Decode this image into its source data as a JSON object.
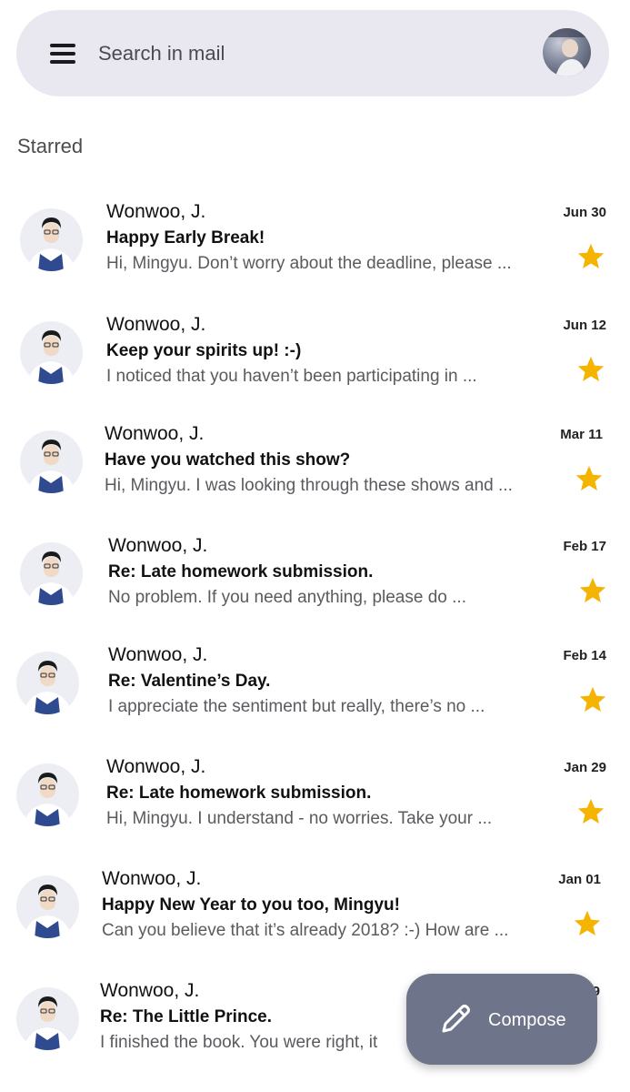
{
  "search": {
    "placeholder": "Search in mail"
  },
  "section": {
    "title": "Starred"
  },
  "emails": [
    {
      "sender": "Wonwoo, J.",
      "subject": "Happy Early Break!",
      "snippet": "Hi, Mingyu. Don’t worry about the deadline, please ...",
      "date": "Jun 30",
      "starred": true
    },
    {
      "sender": "Wonwoo, J.",
      "subject": "Keep your spirits up! :-)",
      "snippet": "I noticed that you haven’t been participating in ...",
      "date": "Jun 12",
      "starred": true
    },
    {
      "sender": "Wonwoo, J.",
      "subject": "Have you watched this show?",
      "snippet": "Hi, Mingyu. I was looking through these shows and ...",
      "date": "Mar 11",
      "starred": true
    },
    {
      "sender": "Wonwoo, J.",
      "subject": "Re: Late homework submission.",
      "snippet": "No problem. If you need anything, please do ...",
      "date": "Feb 17",
      "starred": true
    },
    {
      "sender": "Wonwoo, J.",
      "subject": "Re: Valentine’s Day.",
      "snippet": "I appreciate the sentiment but really, there’s no ...",
      "date": "Feb 14",
      "starred": true
    },
    {
      "sender": "Wonwoo, J.",
      "subject": "Re: Late homework submission.",
      "snippet": "Hi, Mingyu. I understand - no worries. Take your ...",
      "date": "Jan 29",
      "starred": true
    },
    {
      "sender": "Wonwoo, J.",
      "subject": "Happy New Year to you too, Mingyu!",
      "snippet": "Can you believe that it’s already 2018? :-) How are ...",
      "date": "Jan 01",
      "starred": true
    },
    {
      "sender": "Wonwoo, J.",
      "subject": "Re: The Little Prince.",
      "snippet": "I finished the book. You were right, it",
      "date": "9",
      "starred": false
    }
  ],
  "fab": {
    "label": "Compose",
    "icon": "pencil-icon"
  },
  "colors": {
    "search_bar": "#e9e8f0",
    "star": "#f5b400",
    "fab": "#6e7489"
  }
}
